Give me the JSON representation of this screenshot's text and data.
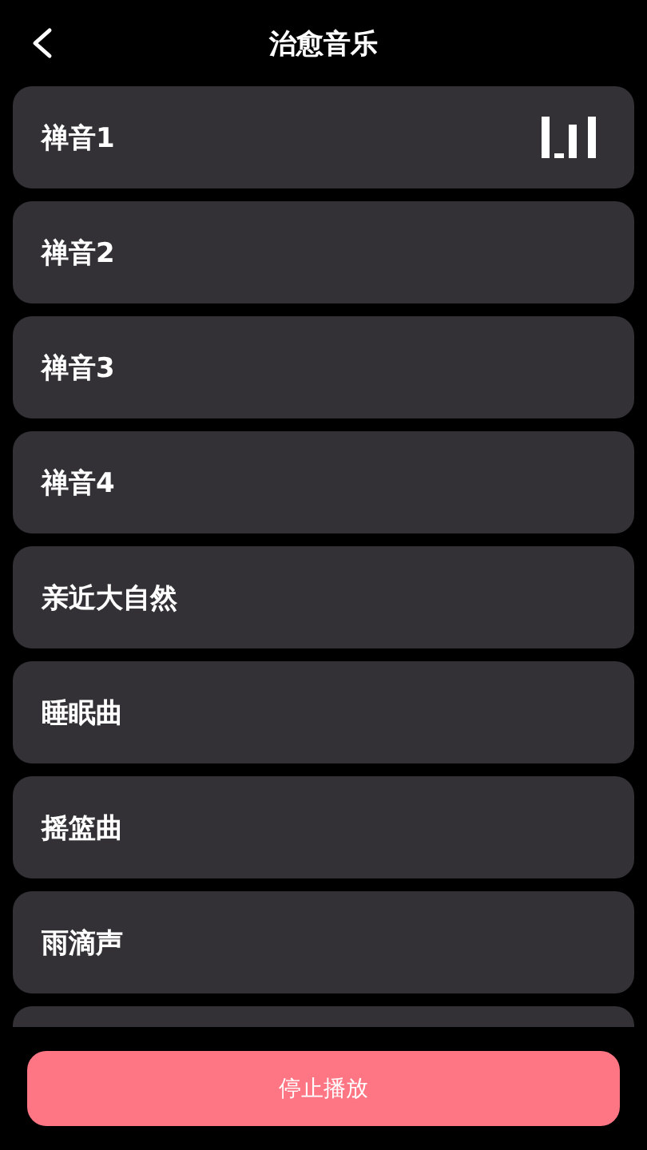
{
  "header": {
    "title": "治愈音乐"
  },
  "tracks": [
    {
      "name": "禅音1",
      "playing": true
    },
    {
      "name": "禅音2",
      "playing": false
    },
    {
      "name": "禅音3",
      "playing": false
    },
    {
      "name": "禅音4",
      "playing": false
    },
    {
      "name": "亲近大自然",
      "playing": false
    },
    {
      "name": "睡眠曲",
      "playing": false
    },
    {
      "name": "摇篮曲",
      "playing": false
    },
    {
      "name": "雨滴声",
      "playing": false
    }
  ],
  "stop_button": {
    "label": "停止播放"
  }
}
